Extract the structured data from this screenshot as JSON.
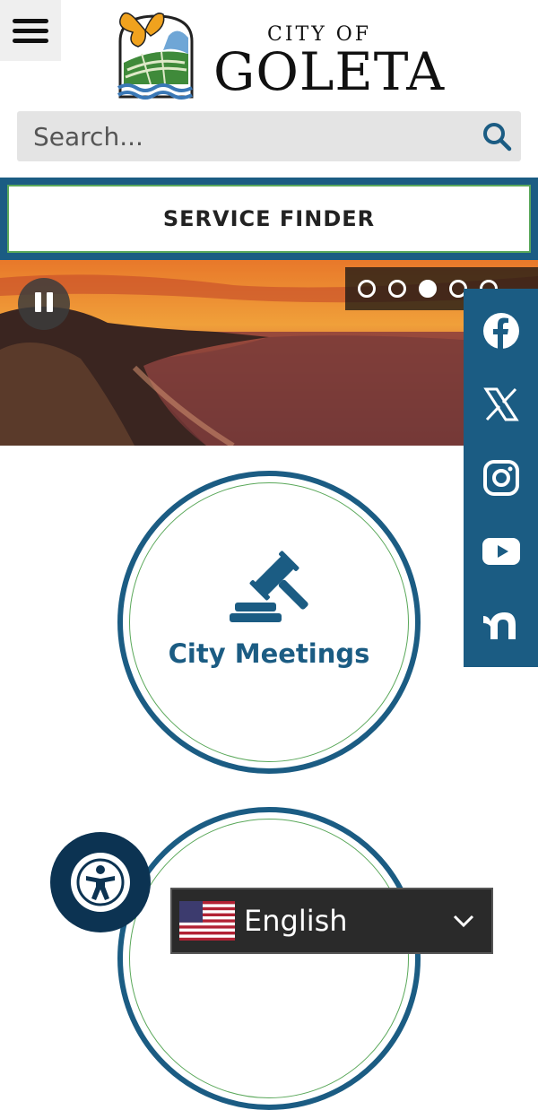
{
  "header": {
    "menu_icon": "hamburger-menu-icon",
    "logo": {
      "line1": "CITY OF",
      "line2": "GOLETA"
    }
  },
  "search": {
    "placeholder": "Search...",
    "icon": "search-icon"
  },
  "service_finder": {
    "label": "SERVICE FINDER"
  },
  "hero": {
    "pause_icon": "pause-icon",
    "slide_count": 5,
    "active_slide": 3
  },
  "social": {
    "items": [
      "facebook-icon",
      "x-icon",
      "instagram-icon",
      "youtube-icon",
      "nextdoor-icon"
    ]
  },
  "quick_links": [
    {
      "label": "City Meetings",
      "icon": "gavel-icon"
    }
  ],
  "accessibility": {
    "icon": "accessibility-icon"
  },
  "language": {
    "label": "English",
    "flag": "us-flag-icon",
    "chevron": "chevron-down-icon"
  },
  "colors": {
    "brand_blue": "#1b5c83",
    "accent_green": "#5aa85a",
    "dark_navy": "#0c3352"
  }
}
